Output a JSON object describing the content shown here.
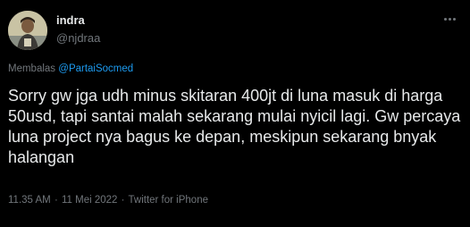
{
  "author": {
    "name": "indra",
    "handle": "@njdraa"
  },
  "reply": {
    "prefix": "Membalas",
    "mention": "@PartaiSocmed"
  },
  "tweet": {
    "text": "Sorry gw jga udh minus skitaran 400jt di luna masuk di harga 50usd, tapi santai malah sekarang mulai nyicil lagi. Gw percaya luna project nya bagus ke depan, meskipun sekarang bnyak halangan"
  },
  "meta": {
    "time": "11.35 AM",
    "separator": "·",
    "date": "11 Mei 2022",
    "source": "Twitter for iPhone"
  },
  "colors": {
    "background": "#000000",
    "text": "#e7e9ea",
    "secondary": "#71767b",
    "link": "#1d9bf0"
  },
  "icons": {
    "more": "more-horizontal-icon"
  }
}
